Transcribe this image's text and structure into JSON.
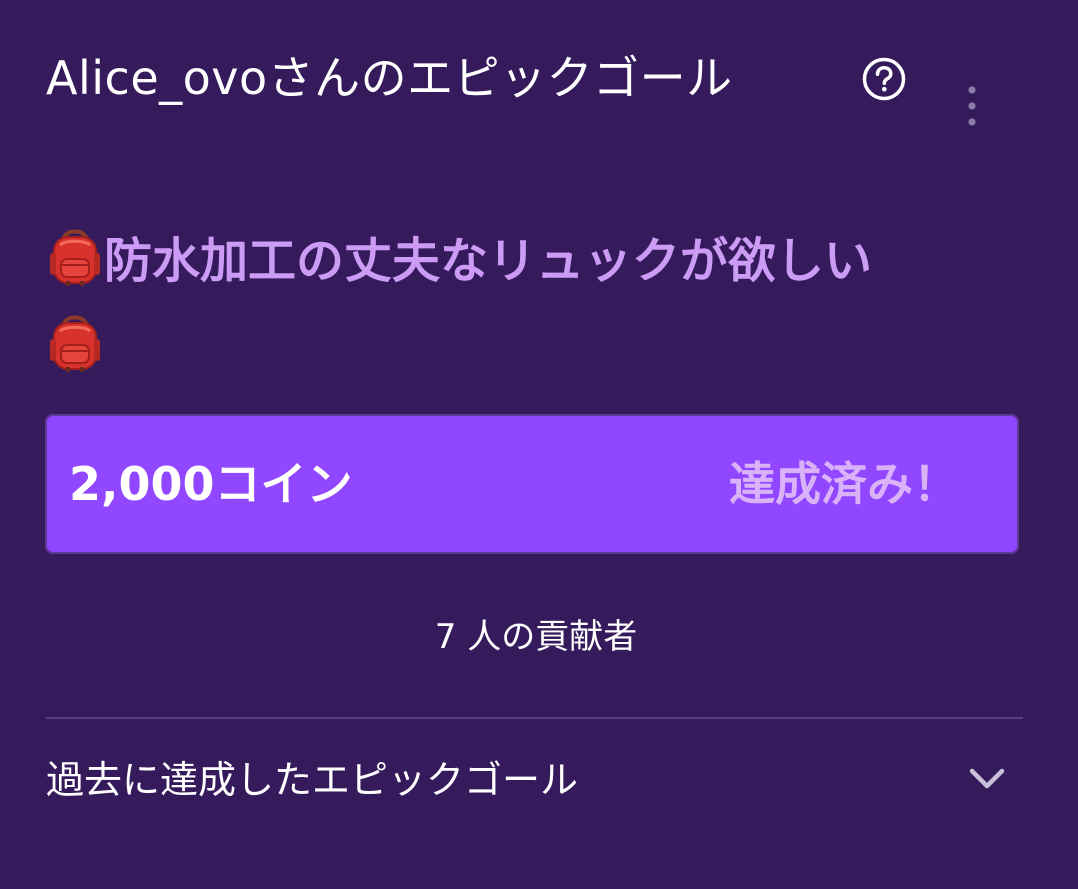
{
  "header": {
    "title": "Alice_ovoさんのエピックゴール",
    "help_icon": "help-circle-icon",
    "more_icon": "more-vertical-icon"
  },
  "goal": {
    "emoji_icon": "backpack-icon",
    "text": "防水加工の丈夫なリュックが欲しい"
  },
  "progress": {
    "amount": "2,000コイン",
    "status": "達成済み！",
    "fraction": 1.0
  },
  "contributors": "7 人の貢献者",
  "past_goals": {
    "label": "過去に達成したエピックゴール",
    "icon": "chevron-down-icon"
  },
  "colors": {
    "background": "#361b5c",
    "accent": "#9146ff",
    "goal_text": "#cb9bf5",
    "status_text": "#d9b2fa"
  }
}
